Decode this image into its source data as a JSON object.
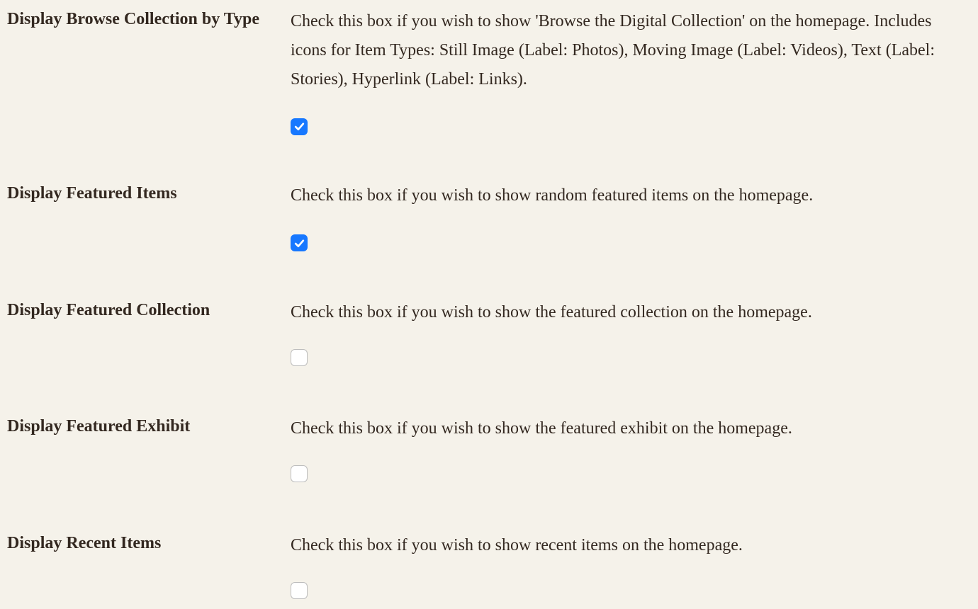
{
  "settings": [
    {
      "label": "Display Browse Collection by Type",
      "description": "Check this box if you wish to show 'Browse the Digital Collection' on the homepage. Includes icons for Item Types: Still Image (Label: Photos), Moving Image (Label: Videos), Text (Label: Stories), Hyperlink (Label: Links).",
      "checked": true
    },
    {
      "label": "Display Featured Items",
      "description": "Check this box if you wish to show random featured items on the homepage.",
      "checked": true
    },
    {
      "label": "Display Featured Collection",
      "description": "Check this box if you wish to show the featured collection on the homepage.",
      "checked": false
    },
    {
      "label": "Display Featured Exhibit",
      "description": "Check this box if you wish to show the featured exhibit on the homepage.",
      "checked": false
    },
    {
      "label": "Display Recent Items",
      "description": "Check this box if you wish to show recent items on the homepage.",
      "checked": false
    }
  ]
}
